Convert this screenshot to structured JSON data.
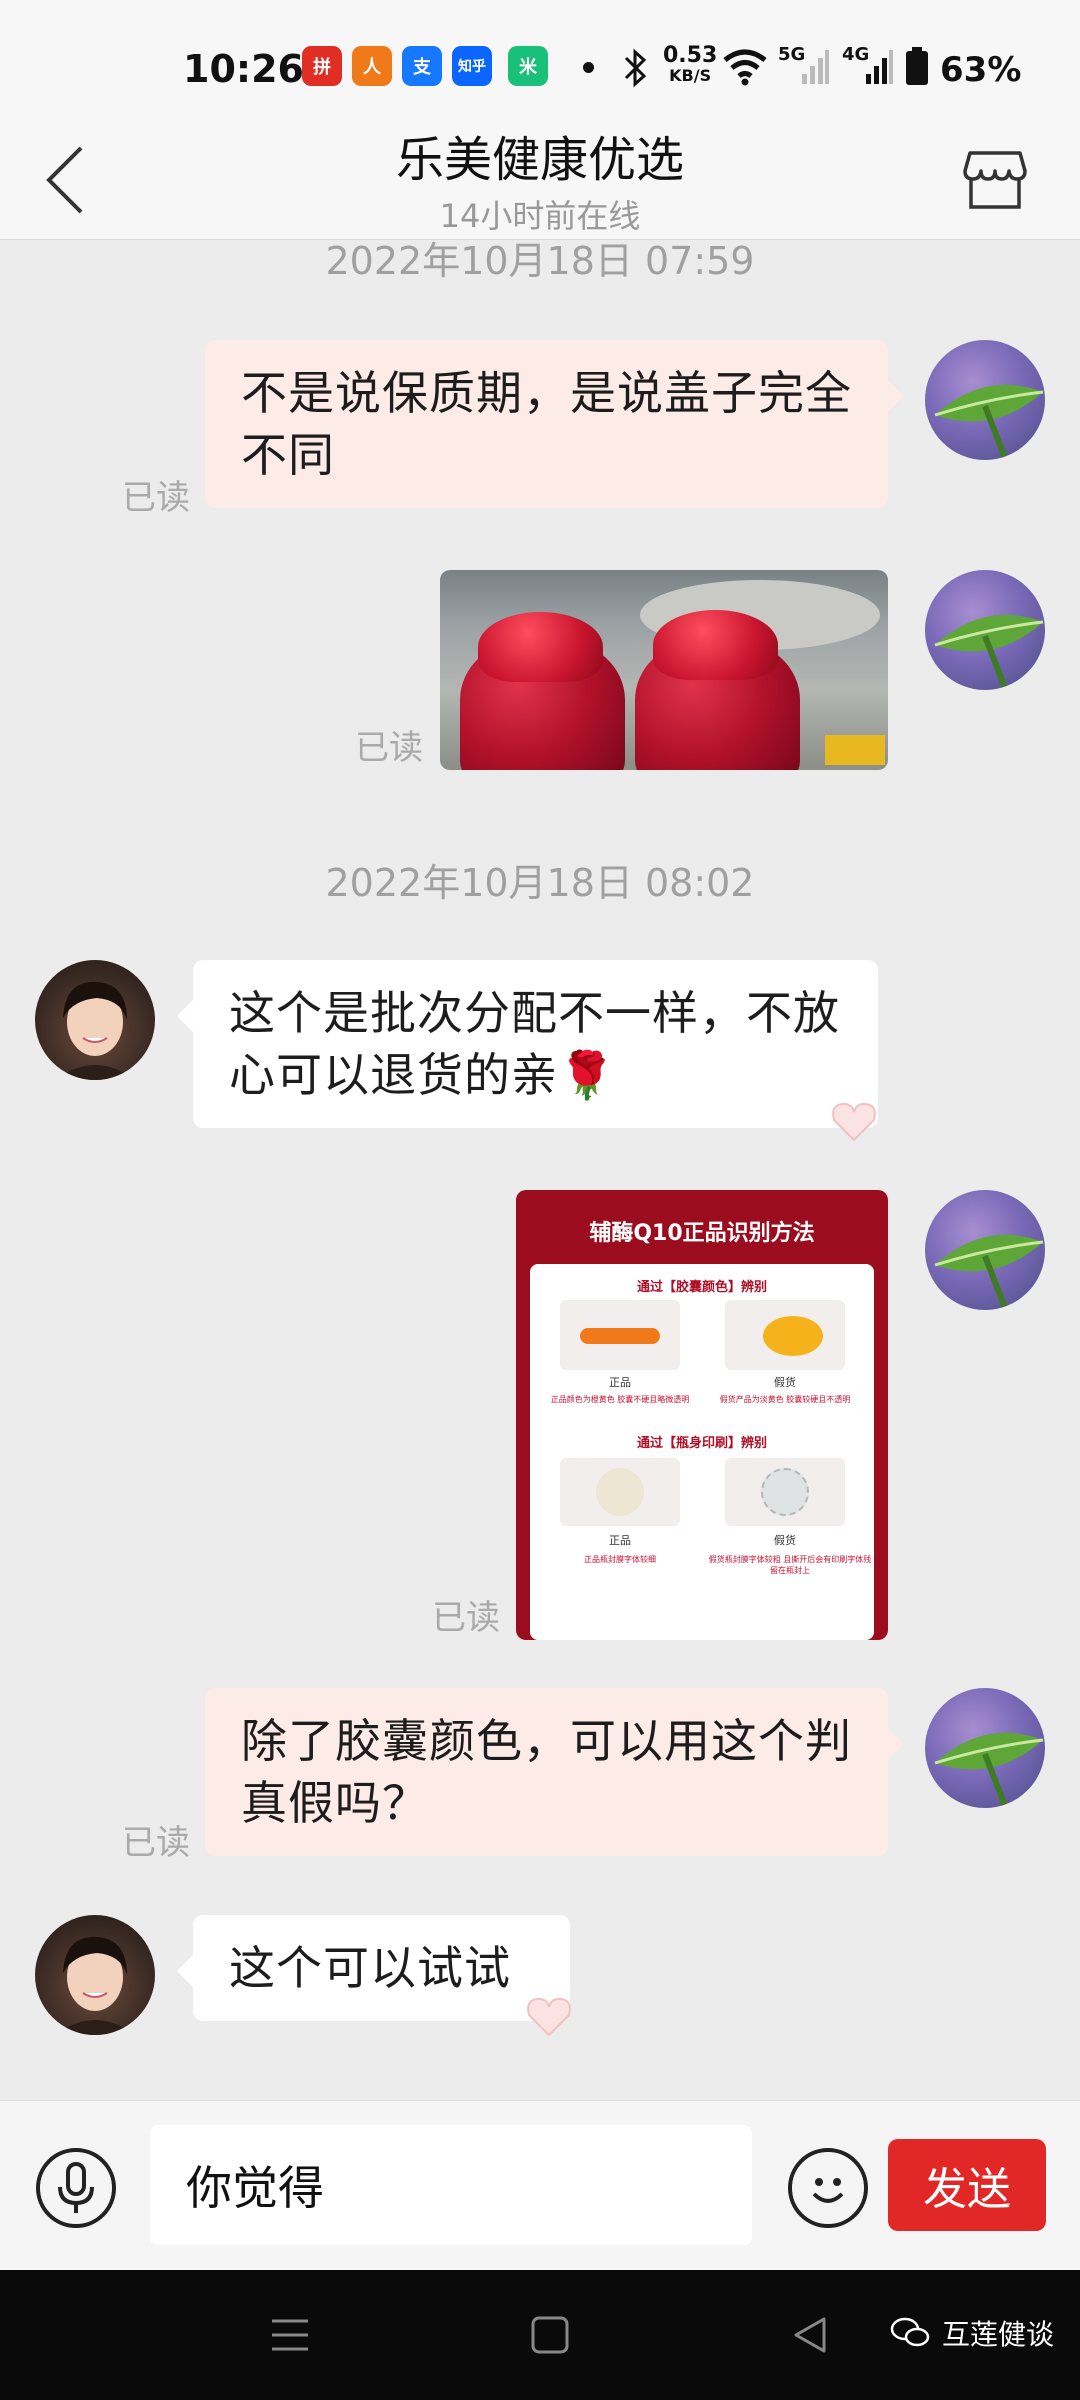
{
  "status_bar": {
    "time": "10:26",
    "network_speed_value": "0.53",
    "network_speed_unit": "KB/S",
    "signal_1": "5G",
    "signal_2": "4G",
    "battery": "63%",
    "app_icons": [
      {
        "name": "pinduoduo-app-icon",
        "glyph": "拼",
        "color": "#e02e24"
      },
      {
        "name": "running-app-icon",
        "glyph": "人",
        "color": "#f07a1a"
      },
      {
        "name": "alipay-app-icon",
        "glyph": "支",
        "color": "#1677ff"
      },
      {
        "name": "zhihu-app-icon",
        "glyph": "知乎",
        "color": "#0a66ff"
      },
      {
        "name": "mi-app-icon",
        "glyph": "米",
        "color": "#19c07a"
      }
    ]
  },
  "header": {
    "title": "乐美健康优选",
    "subtitle": "14小时前在线"
  },
  "messages": {
    "ts1": "2022年10月18日 07:59",
    "m1_text": "不是说保质期，是说盖子完全不同",
    "m1_read": "已读",
    "m2_read": "已读",
    "ts2": "2022年10月18日 08:02",
    "m3_text": "这个是批次分配不一样，不放心可以退货的亲",
    "m3_emoji": "🌹",
    "m4_read": "已读",
    "m5_text": "除了胶囊颜色，可以用这个判真假吗？",
    "m5_read": "已读",
    "m6_text": "这个可以试试"
  },
  "q10_card": {
    "title": "辅酶Q10正品识别方法",
    "section1": "通过【胶囊颜色】辨别",
    "genuine": "正品",
    "fake": "假货",
    "note1_genuine": "正品颜色为橙黄色 胶囊不硬且略微透明",
    "note1_fake": "假货产品为淡黄色 胶囊较硬且不透明",
    "section2": "通过【瓶身印刷】辨别",
    "note2_genuine": "正品瓶封膜字体较细",
    "note2_fake": "假货瓶封膜字体较粗 且撕开后会有印刷字体残留在瓶封上"
  },
  "input_bar": {
    "input_value": "你觉得",
    "send_label": "发送"
  },
  "nav_bar": {
    "watermark": "互莲健谈"
  },
  "colors": {
    "accent_red": "#e22826",
    "bubble_out": "#fdebe7",
    "bubble_in": "#ffffff",
    "background": "#ececec"
  }
}
